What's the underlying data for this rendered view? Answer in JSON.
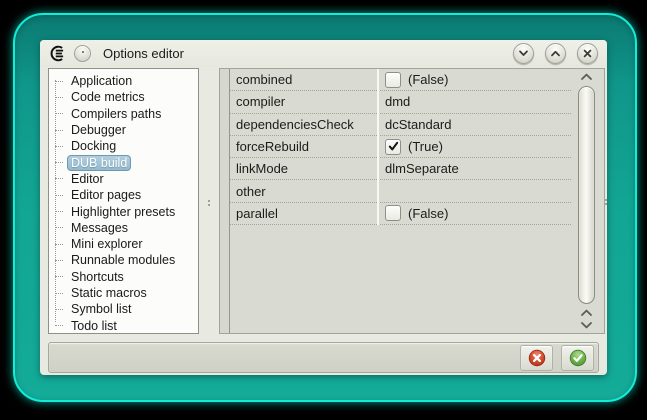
{
  "window": {
    "title": "Options editor",
    "controls": {
      "minimize": "chevron-down",
      "maximize": "chevron-up",
      "close": "close-x"
    }
  },
  "sidebar": {
    "items": [
      {
        "label": "Application",
        "selected": false
      },
      {
        "label": "Code metrics",
        "selected": false
      },
      {
        "label": "Compilers paths",
        "selected": false
      },
      {
        "label": "Debugger",
        "selected": false
      },
      {
        "label": "Docking",
        "selected": false
      },
      {
        "label": "DUB build",
        "selected": true
      },
      {
        "label": "Editor",
        "selected": false
      },
      {
        "label": "Editor pages",
        "selected": false
      },
      {
        "label": "Highlighter presets",
        "selected": false
      },
      {
        "label": "Messages",
        "selected": false
      },
      {
        "label": "Mini explorer",
        "selected": false
      },
      {
        "label": "Runnable modules",
        "selected": false
      },
      {
        "label": "Shortcuts",
        "selected": false
      },
      {
        "label": "Static macros",
        "selected": false
      },
      {
        "label": "Symbol list",
        "selected": false
      },
      {
        "label": "Todo list",
        "selected": false
      }
    ]
  },
  "inspector": {
    "rows": [
      {
        "name": "combined",
        "kind": "checkbox",
        "checked": false,
        "value": "(False)"
      },
      {
        "name": "compiler",
        "kind": "text",
        "checked": false,
        "value": "dmd"
      },
      {
        "name": "dependenciesCheck",
        "kind": "text",
        "checked": false,
        "value": "dcStandard"
      },
      {
        "name": "forceRebuild",
        "kind": "checkbox",
        "checked": true,
        "value": "(True)"
      },
      {
        "name": "linkMode",
        "kind": "text",
        "checked": false,
        "value": "dlmSeparate"
      },
      {
        "name": "other",
        "kind": "text",
        "checked": false,
        "value": ""
      },
      {
        "name": "parallel",
        "kind": "checkbox",
        "checked": false,
        "value": "(False)"
      }
    ]
  },
  "statusbar": {
    "buttons": [
      {
        "name": "cancel",
        "icon": "cancel-circle-icon"
      },
      {
        "name": "accept",
        "icon": "accept-circle-icon"
      }
    ]
  },
  "colors": {
    "frame_teal": "#12a593",
    "frame_edge_cyan": "#14ecd7",
    "dialog_bg": "#e8e9e0",
    "grid_bg": "#d9dad1",
    "selection_bg": "#9fc0d4",
    "selection_border": "#6e9ab1",
    "cancel_red": "#cf4026",
    "accept_green": "#61ad43"
  }
}
